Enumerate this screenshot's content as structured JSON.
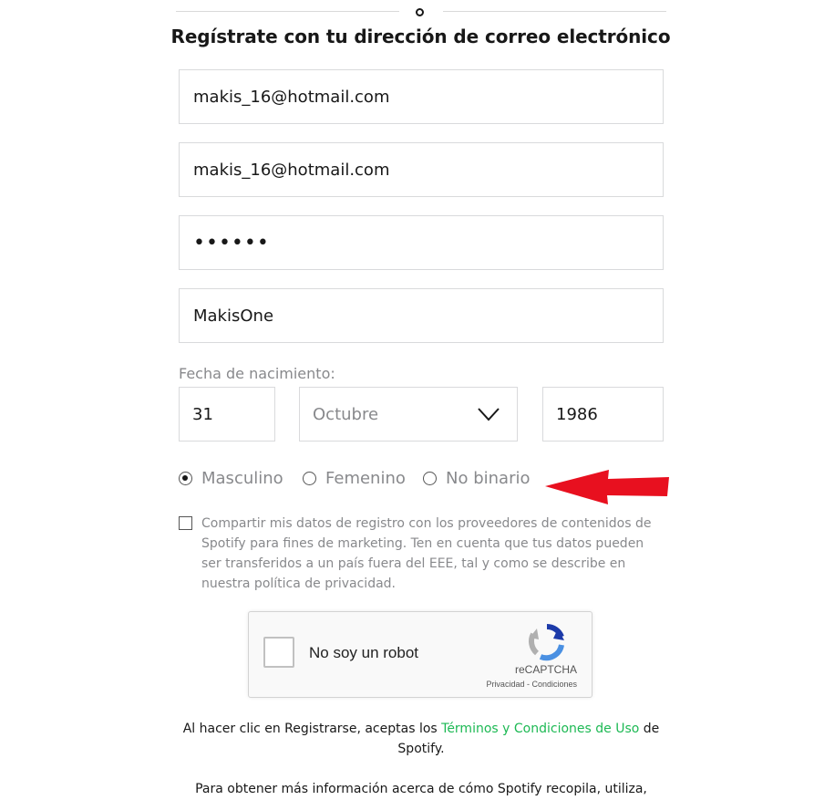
{
  "header": {
    "divider_text": "o",
    "title": "Regístrate con tu dirección de correo electrónico"
  },
  "form": {
    "email": "makis_16@hotmail.com",
    "email_confirm": "makis_16@hotmail.com",
    "password_masked": "••••••",
    "profile_name": "MakisOne",
    "dob": {
      "label": "Fecha de nacimiento:",
      "day": "31",
      "month": "Octubre",
      "year": "1986"
    },
    "gender": {
      "options": [
        "Masculino",
        "Femenino",
        "No binario"
      ],
      "selected": "Masculino"
    },
    "marketing_consent": {
      "checked": false,
      "text": "Compartir mis datos de registro con los proveedores de contenidos de Spotify para fines de marketing. Ten en cuenta que tus datos pueden ser transferidos a un país fuera del EEE, tal y como se describe en nuestra política de privacidad."
    }
  },
  "annotation": {
    "arrow_color": "#e8101f",
    "icon": "arrow-left-icon"
  },
  "captcha": {
    "label": "No soy un robot",
    "brand": "reCAPTCHA",
    "links": "Privacidad - Condiciones",
    "icon": "recaptcha-logo-icon"
  },
  "footer": {
    "terms_prefix": "Al hacer clic en Registrarse, aceptas los ",
    "terms_link": "Términos y Condiciones de Uso",
    "terms_suffix": " de Spotify.",
    "more_info": "Para obtener más información acerca de cómo Spotify recopila, utiliza,"
  },
  "colors": {
    "link": "#1db954",
    "muted_text": "#88898c",
    "border": "#d9dadc"
  }
}
